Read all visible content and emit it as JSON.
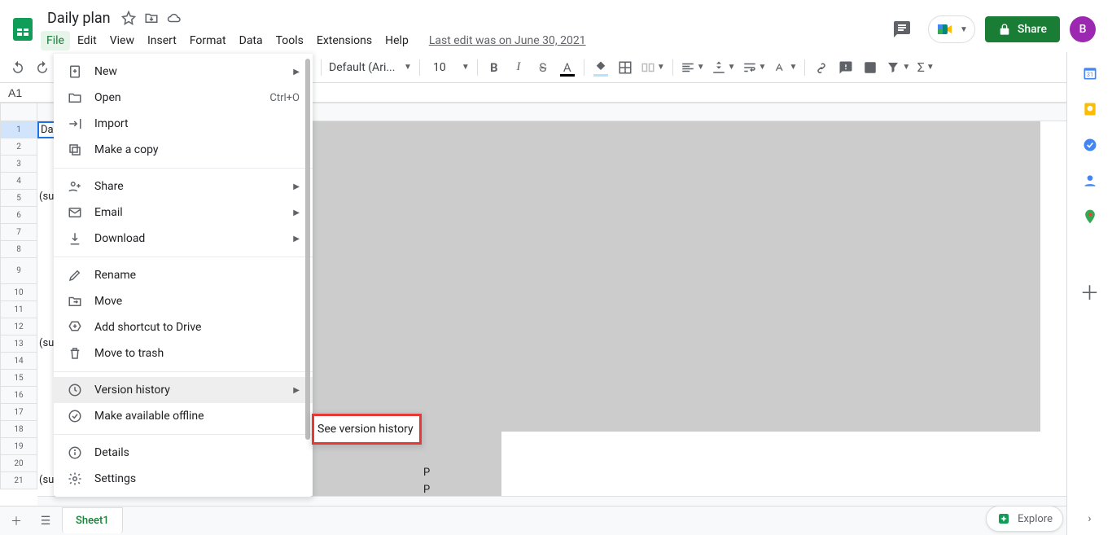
{
  "doc": {
    "title": "Daily plan"
  },
  "menu": {
    "items": [
      "File",
      "Edit",
      "View",
      "Insert",
      "Format",
      "Data",
      "Tools",
      "Extensions",
      "Help"
    ],
    "last_edit": "Last edit was on June 30, 2021"
  },
  "share_label": "Share",
  "avatar_letter": "B",
  "toolbar": {
    "font": "Default (Ari...",
    "size": "10"
  },
  "name_box": "A1",
  "cells": {
    "a1": "Da",
    "a5": "(su",
    "a13": "(su",
    "a21": "(su"
  },
  "row_nums": [
    "1",
    "2",
    "3",
    "4",
    "5",
    "6",
    "7",
    "8",
    "9",
    "10",
    "11",
    "12",
    "13",
    "14",
    "15",
    "16",
    "17",
    "18",
    "19",
    "20",
    "21"
  ],
  "sheet_tab": "Sheet1",
  "explore": "Explore",
  "file_menu": {
    "new": "New",
    "open": "Open",
    "open_sc": "Ctrl+O",
    "import": "Import",
    "copy": "Make a copy",
    "share": "Share",
    "email": "Email",
    "download": "Download",
    "rename": "Rename",
    "move": "Move",
    "shortcut": "Add shortcut to Drive",
    "trash": "Move to trash",
    "version": "Version history",
    "offline": "Make available offline",
    "details": "Details",
    "settings": "Settings"
  },
  "submenu": {
    "see_version": "See version history"
  }
}
